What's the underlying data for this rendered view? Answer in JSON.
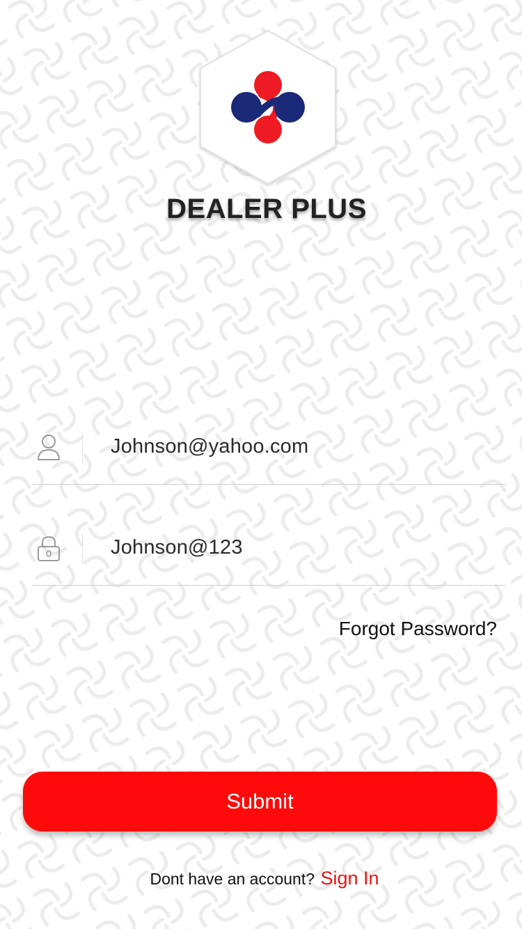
{
  "brand": {
    "name": "DEALER PLUS",
    "logo_icon": "dealer-plus-logo"
  },
  "login_form": {
    "email": {
      "icon": "user-icon",
      "value": "Johnson@yahoo.com"
    },
    "password": {
      "icon": "lock-icon",
      "value": "Johnson@123"
    },
    "forgot_password_label": "Forgot Password?",
    "submit_label": "Submit"
  },
  "footer": {
    "prompt_text": "Dont have an account?",
    "signin_label": "Sign In"
  },
  "colors": {
    "accent": "#ff0a0a",
    "logo_red": "#ee1b24",
    "logo_navy": "#1a2a78",
    "text_dark": "#222222"
  }
}
